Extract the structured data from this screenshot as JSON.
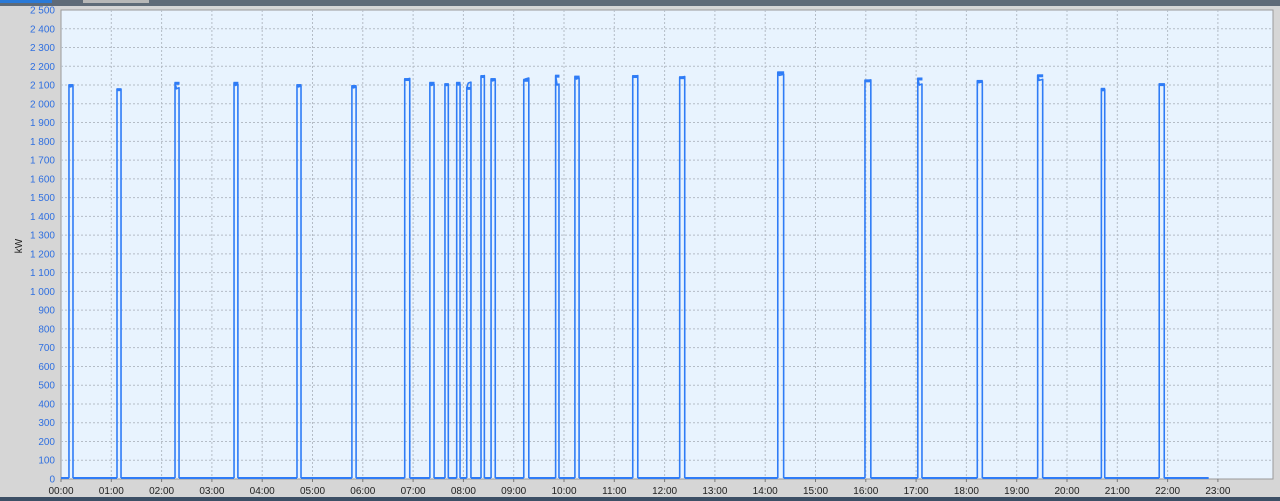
{
  "chart_data": {
    "type": "line",
    "title": "",
    "xlabel": "",
    "ylabel": "kW",
    "ylim": [
      0,
      2500
    ],
    "ytick_step": 100,
    "yticks": [
      "0",
      "100",
      "200",
      "300",
      "400",
      "500",
      "600",
      "700",
      "800",
      "900",
      "1 000",
      "1 100",
      "1 200",
      "1 300",
      "1 400",
      "1 500",
      "1 600",
      "1 700",
      "1 800",
      "1 900",
      "2 000",
      "2 100",
      "2 200",
      "2 300",
      "2 400",
      "2 500"
    ],
    "xlim_minutes": [
      0,
      1440
    ],
    "xticks": [
      "00:00",
      "01:00",
      "02:00",
      "03:00",
      "04:00",
      "05:00",
      "06:00",
      "07:00",
      "08:00",
      "09:00",
      "10:00",
      "11:00",
      "12:00",
      "13:00",
      "14:00",
      "15:00",
      "16:00",
      "17:00",
      "18:00",
      "19:00",
      "20:00",
      "21:00",
      "22:00",
      "23:00"
    ],
    "grid": true,
    "series_color": "#2f7cf6",
    "data_end_minute": 1369,
    "baseline_value": 0,
    "pulses": [
      {
        "start": 9.5,
        "end": 14.3,
        "peak": 2100,
        "plateau": 2090
      },
      {
        "start": 66.8,
        "end": 71.6,
        "peak": 2078,
        "plateau": 2072
      },
      {
        "start": 136,
        "end": 140.8,
        "peak": 2112,
        "plateau": 2080
      },
      {
        "start": 206.4,
        "end": 211,
        "peak": 2112,
        "plateau": 2098
      },
      {
        "start": 281.5,
        "end": 286.3,
        "peak": 2100,
        "plateau": 2090
      },
      {
        "start": 347,
        "end": 352,
        "peak": 2095,
        "plateau": 2085
      },
      {
        "start": 410,
        "end": 416,
        "peak": 2132,
        "plateau": 2130
      },
      {
        "start": 440,
        "end": 445,
        "peak": 2112,
        "plateau": 2098
      },
      {
        "start": 458,
        "end": 462,
        "peak": 2105,
        "plateau": 2098
      },
      {
        "start": 472,
        "end": 476,
        "peak": 2112,
        "plateau": 2100
      },
      {
        "start": 484,
        "end": 489,
        "peak": 2085,
        "plateau": 2110
      },
      {
        "start": 501,
        "end": 505,
        "peak": 2148,
        "plateau": 2145
      },
      {
        "start": 513,
        "end": 518,
        "peak": 2132,
        "plateau": 2122
      },
      {
        "start": 552,
        "end": 558,
        "peak": 2128,
        "plateau": 2132
      },
      {
        "start": 590,
        "end": 594,
        "peak": 2150,
        "plateau": 2100
      },
      {
        "start": 613,
        "end": 618,
        "peak": 2145,
        "plateau": 2132
      },
      {
        "start": 682,
        "end": 688,
        "peak": 2148,
        "plateau": 2145
      },
      {
        "start": 738,
        "end": 744,
        "peak": 2142,
        "plateau": 2140
      },
      {
        "start": 855,
        "end": 862,
        "peak": 2168,
        "plateau": 2152
      },
      {
        "start": 959,
        "end": 966,
        "peak": 2125,
        "plateau": 2122
      },
      {
        "start": 1022,
        "end": 1027,
        "peak": 2135,
        "plateau": 2100
      },
      {
        "start": 1093,
        "end": 1099,
        "peak": 2122,
        "plateau": 2112
      },
      {
        "start": 1165,
        "end": 1171,
        "peak": 2152,
        "plateau": 2125
      },
      {
        "start": 1241,
        "end": 1245,
        "peak": 2080,
        "plateau": 2070
      },
      {
        "start": 1310,
        "end": 1316,
        "peak": 2105,
        "plateau": 2100
      }
    ]
  }
}
